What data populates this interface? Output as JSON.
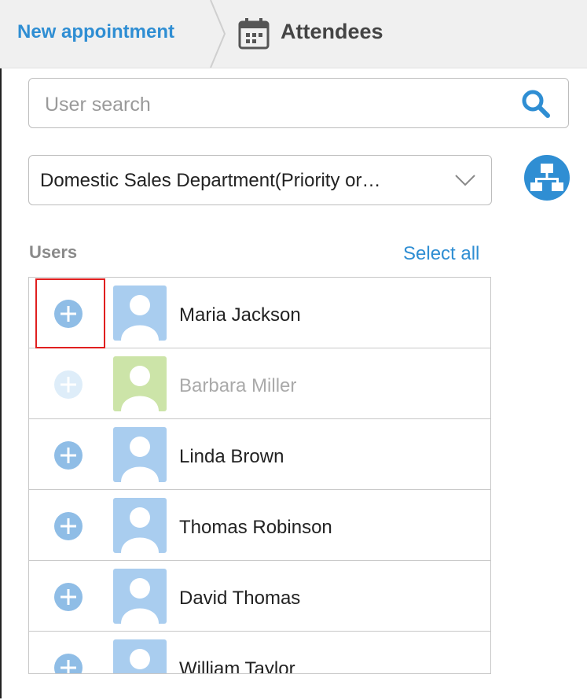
{
  "header": {
    "breadcrumb_label": "New appointment",
    "title": "Attendees",
    "title_icon": "calendar-icon"
  },
  "search": {
    "placeholder": "User search",
    "value": "",
    "icon": "search-icon"
  },
  "department": {
    "selected": "Domestic Sales Department(Priority or…",
    "icon": "chevron-down-icon",
    "org_button_icon": "org-chart-icon"
  },
  "users": {
    "label": "Users",
    "select_all_label": "Select all",
    "items": [
      {
        "name": "Maria Jackson",
        "avatar_color": "#a9cdef",
        "disabled": false
      },
      {
        "name": "Barbara Miller",
        "avatar_color": "#cce4a8",
        "disabled": true
      },
      {
        "name": "Linda Brown",
        "avatar_color": "#a9cdef",
        "disabled": false
      },
      {
        "name": "Thomas Robinson",
        "avatar_color": "#a9cdef",
        "disabled": false
      },
      {
        "name": "David Thomas",
        "avatar_color": "#a9cdef",
        "disabled": false
      },
      {
        "name": "William Taylor",
        "avatar_color": "#a9cdef",
        "disabled": false
      }
    ]
  },
  "colors": {
    "accent": "#2f8ed3",
    "add_button": "#8fbde6",
    "add_button_disabled": "#deedf9",
    "highlight": "#e01f1f"
  }
}
